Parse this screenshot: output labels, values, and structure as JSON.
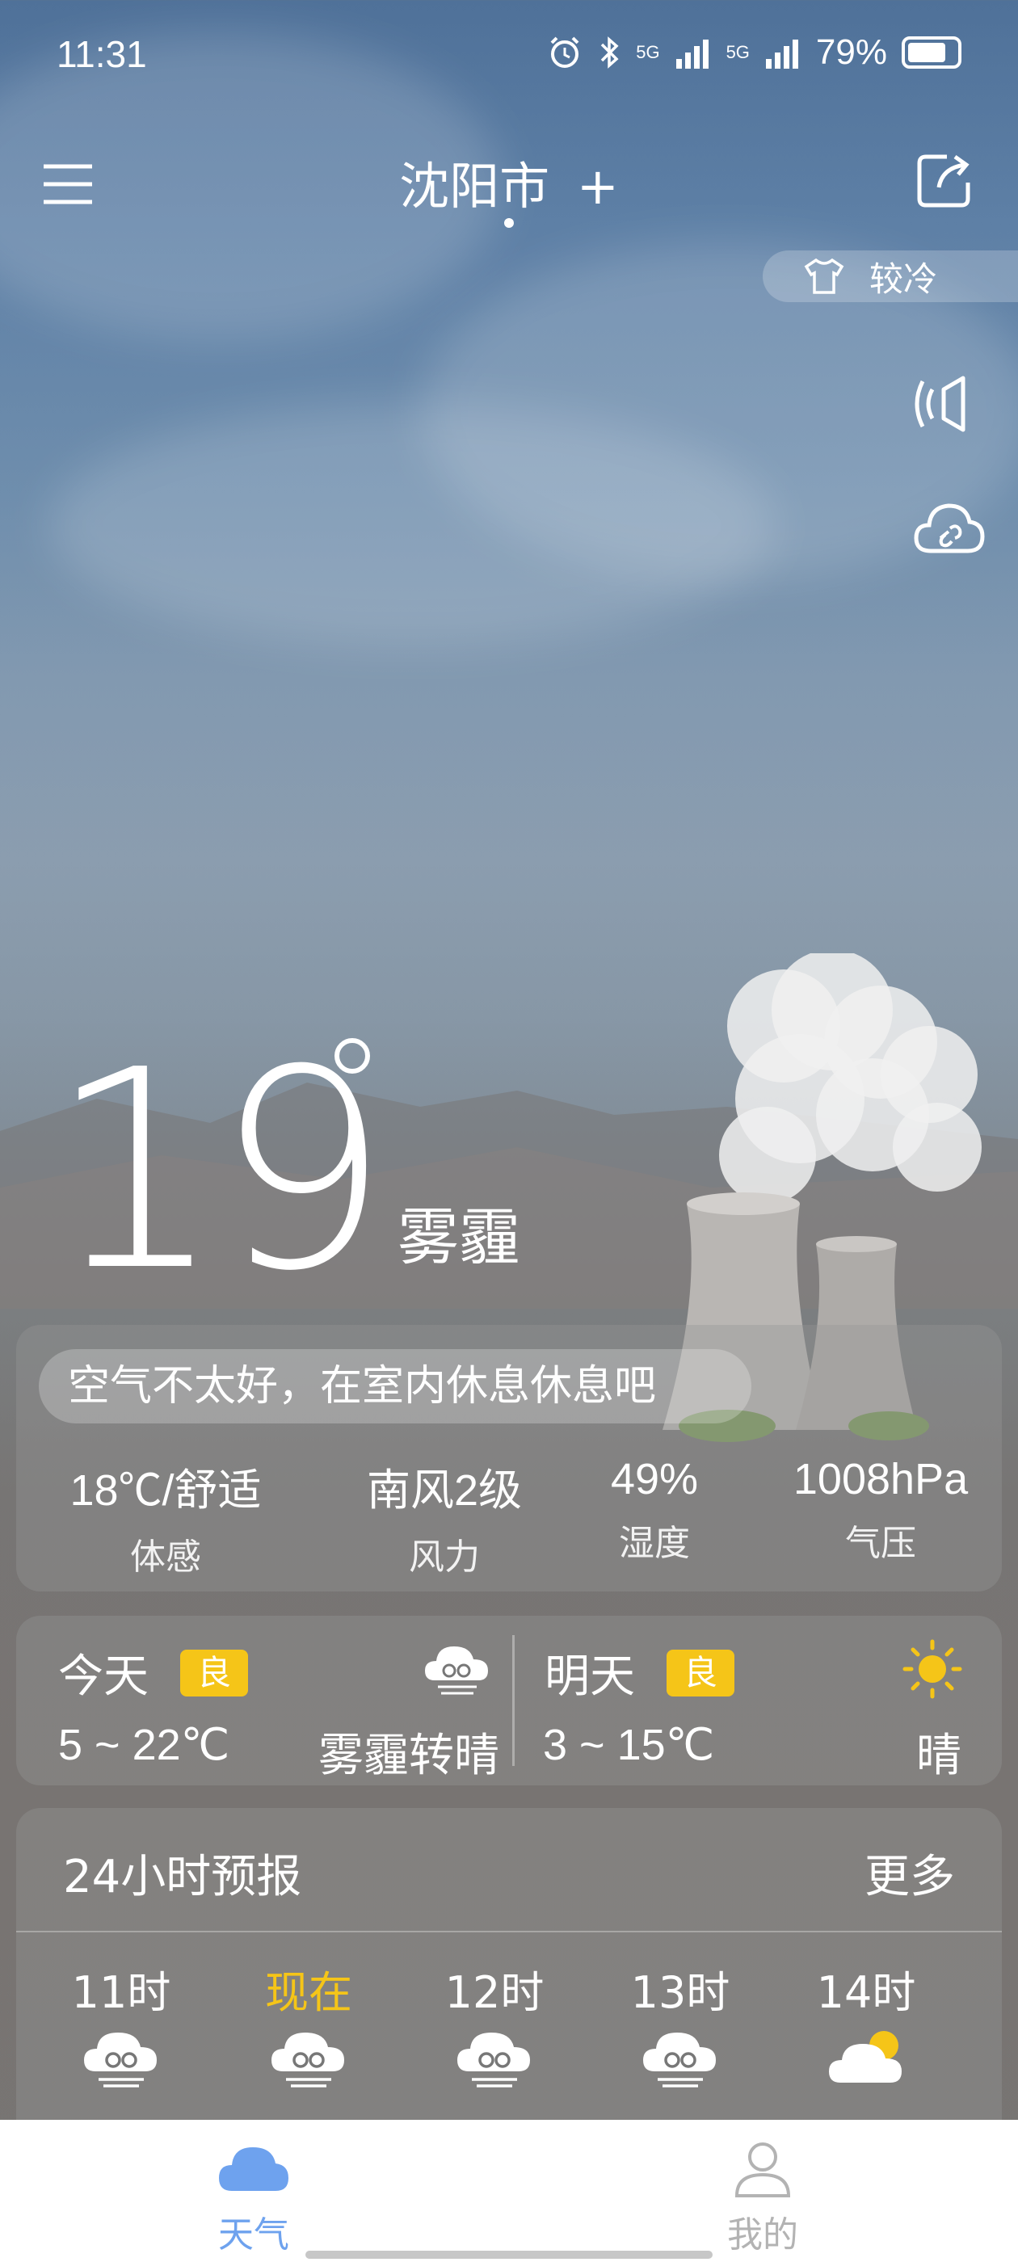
{
  "status_bar": {
    "time": "11:31",
    "signal_1": "5G",
    "signal_2": "5G",
    "battery": "79%",
    "battery_level": 0.79
  },
  "header": {
    "city": "沈阳市",
    "add": "+"
  },
  "dress_tip": {
    "label": "较冷"
  },
  "current": {
    "temperature": "19",
    "condition": "雾霾",
    "tip": "空气不太好，在室内休息休息吧"
  },
  "metrics": [
    {
      "value": "18℃/舒适",
      "label": "体感"
    },
    {
      "value": "南风2级",
      "label": "风力"
    },
    {
      "value": "49%",
      "label": "湿度"
    },
    {
      "value": "1008hPa",
      "label": "气压"
    }
  ],
  "forecast": {
    "today": {
      "name": "今天",
      "aqi": "良",
      "range": "5 ~ 22℃",
      "condition": "雾霾转晴",
      "icon": "haze-icon"
    },
    "tomorrow": {
      "name": "明天",
      "aqi": "良",
      "range": "3 ~ 15℃",
      "condition": "晴",
      "icon": "sun-icon"
    }
  },
  "hourly": {
    "title": "24小时预报",
    "more": "更多",
    "hours": [
      {
        "time": "11时",
        "icon": "haze-icon"
      },
      {
        "time": "现在",
        "icon": "haze-icon"
      },
      {
        "time": "12时",
        "icon": "haze-icon"
      },
      {
        "time": "13时",
        "icon": "haze-icon"
      },
      {
        "time": "14时",
        "icon": "partly-sunny-icon"
      }
    ]
  },
  "tabs": [
    {
      "label": "天气",
      "icon": "cloud-icon",
      "active": true
    },
    {
      "label": "我的",
      "icon": "person-icon",
      "active": false
    }
  ],
  "colors": {
    "accent": "#f5c518",
    "tab_active": "#6ea2ee",
    "tab_inactive": "#b3b3b3"
  }
}
